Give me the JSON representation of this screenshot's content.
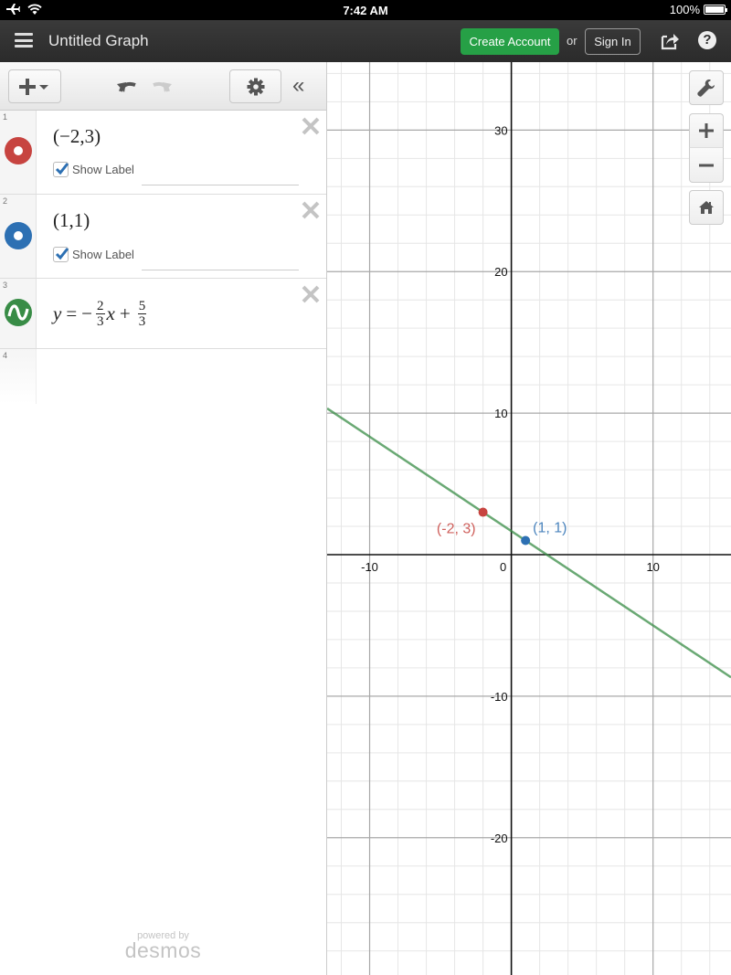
{
  "status_bar": {
    "time": "7:42 AM",
    "battery_text": "100%",
    "battery_level": 1.0,
    "icons": [
      "airplane-icon",
      "wifi-icon"
    ]
  },
  "topbar": {
    "title": "Untitled Graph",
    "create_account_label": "Create Account",
    "or_label": "or",
    "sign_in_label": "Sign In",
    "help_label": "?",
    "create_account_color": "#26a046"
  },
  "expression_toolbar": {
    "collapse_label": "«"
  },
  "expressions": [
    {
      "index": "1",
      "type": "point",
      "latex_text": "(−2,3)",
      "color": "#c74440",
      "show_label_text": "Show Label",
      "show_label_checked": true,
      "label_value": ""
    },
    {
      "index": "2",
      "type": "point",
      "latex_text": "(1,1)",
      "color": "#2d70b3",
      "show_label_text": "Show Label",
      "show_label_checked": true,
      "label_value": ""
    },
    {
      "index": "3",
      "type": "line",
      "lhs": "y",
      "eq": "=",
      "neg": "−",
      "coef_num": "2",
      "coef_den": "3",
      "var": "x",
      "plus": "+",
      "const_num": "5",
      "const_den": "3",
      "color": "#388c46"
    },
    {
      "index": "4",
      "type": "empty"
    }
  ],
  "footer": {
    "powered_by": "powered by",
    "brand": "desmos"
  },
  "chart_data": {
    "type": "line",
    "xlim": [
      -13,
      15.5
    ],
    "ylim": [
      -29.7,
      34.8
    ],
    "grid": true,
    "minor_step": 2,
    "major_step": 10,
    "x_tick_labels": [
      "-10",
      "0",
      "10"
    ],
    "y_tick_labels": [
      "30",
      "20",
      "10",
      "-10",
      "-20"
    ],
    "series": [
      {
        "name": "y = -2/3 x + 5/3",
        "kind": "line",
        "slope": -0.6667,
        "intercept": 1.6667,
        "color": "#388c46"
      },
      {
        "name": "(-2, 3)",
        "kind": "point",
        "x": -2,
        "y": 3,
        "label": "(-2, 3)",
        "label_position": "bottom-left",
        "color": "#c74440"
      },
      {
        "name": "(1, 1)",
        "kind": "point",
        "x": 1,
        "y": 1,
        "label": "(1, 1)",
        "label_position": "top-right",
        "color": "#2d70b3"
      }
    ]
  }
}
